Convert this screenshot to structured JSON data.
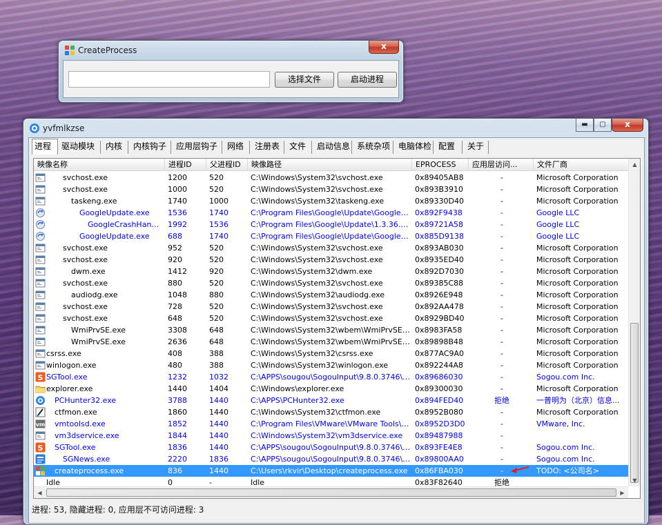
{
  "createprocess_window": {
    "title": "CreateProcess",
    "path_value": "",
    "select_file_label": "选择文件",
    "start_process_label": "启动进程",
    "close_glyph": "x"
  },
  "main_window": {
    "title": "yvfmlkzse",
    "minimize_glyph": "▬",
    "maximize_glyph": "▢",
    "close_glyph": "x"
  },
  "tabs": [
    "进程",
    "驱动模块",
    "内核",
    "内核钩子",
    "应用层钩子",
    "网络",
    "注册表",
    "文件",
    "启动信息",
    "系统杂项",
    "电脑体检",
    "配置",
    "关于"
  ],
  "columns": [
    "映像名称",
    "进程ID",
    "父进程ID",
    "映像路径",
    "EPROCESS",
    "应用层访问...",
    "文件厂商"
  ],
  "colors": {
    "normal": "#000000",
    "blue": "#0000ee",
    "selected_bg": "#3399ff"
  },
  "rows": [
    {
      "name": "svchost.exe",
      "indent": 2,
      "icon": "window-icon",
      "pid": "1200",
      "ppid": "520",
      "path": "C:\\Windows\\System32\\svchost.exe",
      "eprocess": "0x89405AB8",
      "access": "-",
      "vendor": "Microsoft Corporation",
      "color": "normal"
    },
    {
      "name": "svchost.exe",
      "indent": 2,
      "icon": "window-icon",
      "pid": "1000",
      "ppid": "520",
      "path": "C:\\Windows\\System32\\svchost.exe",
      "eprocess": "0x893B3910",
      "access": "-",
      "vendor": "Microsoft Corporation",
      "color": "normal"
    },
    {
      "name": "taskeng.exe",
      "indent": 3,
      "icon": "window-icon",
      "pid": "1740",
      "ppid": "1000",
      "path": "C:\\Windows\\System32\\taskeng.exe",
      "eprocess": "0x89330D40",
      "access": "-",
      "vendor": "Microsoft Corporation",
      "color": "normal"
    },
    {
      "name": "GoogleUpdate.exe",
      "indent": 4,
      "icon": "google-update-icon",
      "pid": "1536",
      "ppid": "1740",
      "path": "C:\\Program Files\\Google\\Update\\GoogleUpd...",
      "eprocess": "0x892F9438",
      "access": "-",
      "vendor": "Google LLC",
      "color": "blue"
    },
    {
      "name": "GoogleCrashHandle...",
      "indent": 5,
      "icon": "google-update-icon",
      "pid": "1992",
      "ppid": "1536",
      "path": "C:\\Program Files\\Google\\Update\\1.3.36.112...",
      "eprocess": "0x89721A58",
      "access": "-",
      "vendor": "Google LLC",
      "color": "blue"
    },
    {
      "name": "GoogleUpdate.exe",
      "indent": 4,
      "icon": "google-update-icon",
      "pid": "688",
      "ppid": "1740",
      "path": "C:\\Program Files\\Google\\Update\\GoogleUpd...",
      "eprocess": "0x885D9138",
      "access": "-",
      "vendor": "Google LLC",
      "color": "blue"
    },
    {
      "name": "svchost.exe",
      "indent": 2,
      "icon": "window-icon",
      "pid": "952",
      "ppid": "520",
      "path": "C:\\Windows\\System32\\svchost.exe",
      "eprocess": "0x893AB030",
      "access": "-",
      "vendor": "Microsoft Corporation",
      "color": "normal"
    },
    {
      "name": "svchost.exe",
      "indent": 2,
      "icon": "window-icon",
      "pid": "920",
      "ppid": "520",
      "path": "C:\\Windows\\System32\\svchost.exe",
      "eprocess": "0x8935ED40",
      "access": "-",
      "vendor": "Microsoft Corporation",
      "color": "normal"
    },
    {
      "name": "dwm.exe",
      "indent": 3,
      "icon": "window-icon",
      "pid": "1412",
      "ppid": "920",
      "path": "C:\\Windows\\System32\\dwm.exe",
      "eprocess": "0x892D7030",
      "access": "-",
      "vendor": "Microsoft Corporation",
      "color": "normal"
    },
    {
      "name": "svchost.exe",
      "indent": 2,
      "icon": "window-icon",
      "pid": "880",
      "ppid": "520",
      "path": "C:\\Windows\\System32\\svchost.exe",
      "eprocess": "0x89385C88",
      "access": "-",
      "vendor": "Microsoft Corporation",
      "color": "normal"
    },
    {
      "name": "audiodg.exe",
      "indent": 3,
      "icon": "window-icon",
      "pid": "1048",
      "ppid": "880",
      "path": "C:\\Windows\\System32\\audiodg.exe",
      "eprocess": "0x8926E948",
      "access": "-",
      "vendor": "Microsoft Corporation",
      "color": "normal"
    },
    {
      "name": "svchost.exe",
      "indent": 2,
      "icon": "window-icon",
      "pid": "728",
      "ppid": "520",
      "path": "C:\\Windows\\System32\\svchost.exe",
      "eprocess": "0x892AA478",
      "access": "-",
      "vendor": "Microsoft Corporation",
      "color": "normal"
    },
    {
      "name": "svchost.exe",
      "indent": 2,
      "icon": "window-icon",
      "pid": "648",
      "ppid": "520",
      "path": "C:\\Windows\\System32\\svchost.exe",
      "eprocess": "0x8929BD40",
      "access": "-",
      "vendor": "Microsoft Corporation",
      "color": "normal"
    },
    {
      "name": "WmiPrvSE.exe",
      "indent": 3,
      "icon": "window-icon",
      "pid": "3308",
      "ppid": "648",
      "path": "C:\\Windows\\System32\\wbem\\WmiPrvSE.exe",
      "eprocess": "0x8983FA58",
      "access": "-",
      "vendor": "Microsoft Corporation",
      "color": "normal"
    },
    {
      "name": "WmiPrvSE.exe",
      "indent": 3,
      "icon": "window-icon",
      "pid": "2636",
      "ppid": "648",
      "path": "C:\\Windows\\System32\\wbem\\WmiPrvSE.exe",
      "eprocess": "0x89898B48",
      "access": "-",
      "vendor": "Microsoft Corporation",
      "color": "normal"
    },
    {
      "name": "csrss.exe",
      "indent": 0,
      "icon": "window-icon",
      "pid": "408",
      "ppid": "388",
      "path": "C:\\Windows\\System32\\csrss.exe",
      "eprocess": "0x877AC9A0",
      "access": "-",
      "vendor": "Microsoft Corporation",
      "color": "normal"
    },
    {
      "name": "winlogon.exe",
      "indent": 0,
      "icon": "window-icon",
      "pid": "480",
      "ppid": "388",
      "path": "C:\\Windows\\System32\\winlogon.exe",
      "eprocess": "0x892244A8",
      "access": "-",
      "vendor": "Microsoft Corporation",
      "color": "normal"
    },
    {
      "name": "SGTool.exe",
      "indent": 0,
      "icon": "sogou-icon",
      "pid": "1232",
      "ppid": "1032",
      "path": "C:\\APPS\\sougou\\SogouInput\\9.8.0.3746\\SG...",
      "eprocess": "0x89686030",
      "access": "-",
      "vendor": "Sogou.com Inc.",
      "color": "blue"
    },
    {
      "name": "explorer.exe",
      "indent": 0,
      "icon": "folder-icon",
      "pid": "1440",
      "ppid": "1404",
      "path": "C:\\Windows\\explorer.exe",
      "eprocess": "0x89300030",
      "access": "-",
      "vendor": "Microsoft Corporation",
      "color": "normal"
    },
    {
      "name": "PCHunter32.exe",
      "indent": 1,
      "icon": "pchunter-icon",
      "pid": "3788",
      "ppid": "1440",
      "path": "C:\\APPS\\PCHunter32.exe",
      "eprocess": "0x894FED40",
      "access": "拒绝",
      "vendor": "一普明为（北京）信息...",
      "color": "blue"
    },
    {
      "name": "ctfmon.exe",
      "indent": 1,
      "icon": "pen-icon",
      "pid": "1860",
      "ppid": "1440",
      "path": "C:\\Windows\\System32\\ctfmon.exe",
      "eprocess": "0x8952B080",
      "access": "-",
      "vendor": "Microsoft Corporation",
      "color": "normal"
    },
    {
      "name": "vmtoolsd.exe",
      "indent": 1,
      "icon": "vmware-icon",
      "pid": "1852",
      "ppid": "1440",
      "path": "C:\\Program Files\\VMware\\VMware Tools\\vmt...",
      "eprocess": "0x8952D3D0",
      "access": "-",
      "vendor": "VMware, Inc.",
      "color": "blue"
    },
    {
      "name": "vm3dservice.exe",
      "indent": 1,
      "icon": "window-icon",
      "pid": "1844",
      "ppid": "1440",
      "path": "C:\\Windows\\System32\\vm3dservice.exe",
      "eprocess": "0x89487988",
      "access": "-",
      "vendor": "",
      "color": "blue"
    },
    {
      "name": "SGTool.exe",
      "indent": 1,
      "icon": "sogou-icon",
      "pid": "1836",
      "ppid": "1440",
      "path": "C:\\APPS\\sougou\\SogouInput\\9.8.0.3746\\SG...",
      "eprocess": "0x893FE4E8",
      "access": "-",
      "vendor": "Sogou.com Inc.",
      "color": "blue"
    },
    {
      "name": "SGNews.exe",
      "indent": 2,
      "icon": "sgnews-icon",
      "pid": "2220",
      "ppid": "1836",
      "path": "C:\\APPS\\sougou\\SogouInput\\9.8.0.3746\\SG...",
      "eprocess": "0x89800AA0",
      "access": "-",
      "vendor": "Sogou.com Inc.",
      "color": "blue"
    },
    {
      "name": "createprocess.exe",
      "indent": 1,
      "icon": "createprocess-icon",
      "pid": "836",
      "ppid": "1440",
      "path": "C:\\Users\\rkvir\\Desktop\\createprocess.exe",
      "eprocess": "0x86FBA030",
      "access": "-",
      "vendor": "TODO: <公司名>",
      "color": "selected",
      "selected": true
    },
    {
      "name": "Idle",
      "indent": 0,
      "icon": "none",
      "pid": "0",
      "ppid": "-",
      "path": "Idle",
      "eprocess": "0x83F82640",
      "access": "拒绝",
      "vendor": "",
      "color": "normal"
    }
  ],
  "status_text": "进程: 53, 隐藏进程: 0, 应用层不可访问进程: 3"
}
